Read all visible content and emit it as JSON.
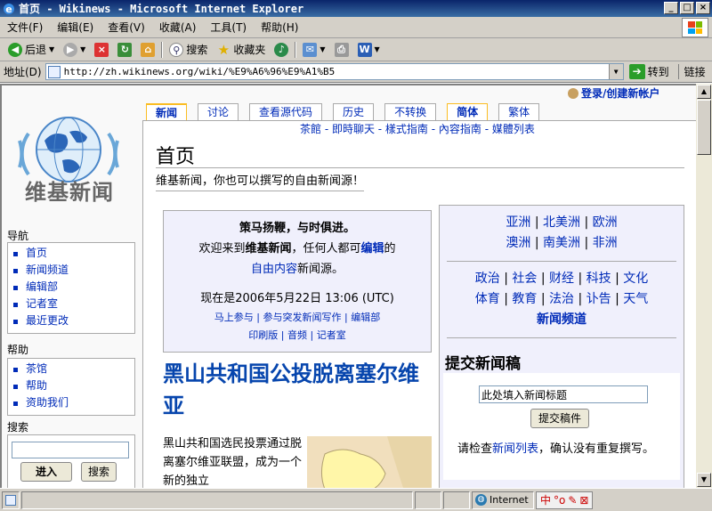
{
  "window": {
    "title": "首页 - Wikinews - Microsoft Internet Explorer",
    "controls": [
      "_",
      "□",
      "×"
    ]
  },
  "menu": [
    "文件(F)",
    "编辑(E)",
    "查看(V)",
    "收藏(A)",
    "工具(T)",
    "帮助(H)"
  ],
  "toolbar": {
    "back": "后退",
    "search": "搜索",
    "favorites": "收藏夹"
  },
  "address": {
    "label": "地址(D)",
    "url": "http://zh.wikinews.org/wiki/%E9%A6%96%E9%A1%B5",
    "go": "转到",
    "links": "链接"
  },
  "status": {
    "zone": "Internet",
    "ime_label": "中"
  },
  "page": {
    "logo_text": "维基新闻",
    "userlink": "登录/创建新帐户",
    "tabs": [
      "新闻",
      "讨论",
      "查看源代码",
      "历史",
      "不转换",
      "简体",
      "繁体"
    ],
    "sublinks": "茶館 - 即時聊天 - 樣式指南 - 內容指南 - 媒體列表",
    "title": "首页",
    "tagline": "维基新闻，你也可以撰写的自由新闻源！",
    "welcome": {
      "motto": "策马扬鞭，与时俱进。",
      "line1_a": "欢迎来到",
      "line1_b": "维基新闻",
      "line1_c": "，任何人都可",
      "line1_d": "编辑",
      "line1_e": "的",
      "line2_a": "自由内容",
      "line2_b": "新闻源。",
      "time": "现在是2006年5月22日  13:06 (UTC)",
      "links1": "马上参与 | 参与突发新闻写作 | 编辑部",
      "links2": "印刷版 | 音频 | 记者室"
    },
    "headline": "黑山共和国公投脱离塞尔维亚",
    "article": "黑山共和国选民投票通过脱离塞尔维亚联盟，成为一个新的独立",
    "regions_row1": [
      "亚洲",
      "北美洲",
      "欧洲"
    ],
    "regions_row2": [
      "澳洲",
      "南美洲",
      "非洲"
    ],
    "topics_row1": [
      "政治",
      "社会",
      "财经",
      "科技",
      "文化"
    ],
    "topics_row2": [
      "体育",
      "教育",
      "法治",
      "讣告",
      "天气"
    ],
    "channel": "新闻频道",
    "submit_head": "提交新闻稿",
    "submit_placeholder": "此处填入新闻标题",
    "submit_button": "提交稿件",
    "submit_note_a": "请检查",
    "submit_note_b": "新闻列表",
    "submit_note_c": "，确认没有重复撰写。"
  },
  "sidebar": {
    "nav_title": "导航",
    "nav": [
      "首页",
      "新闻频道",
      "编辑部",
      "记者室",
      "最近更改"
    ],
    "help_title": "帮助",
    "help": [
      "茶馆",
      "帮助",
      "资助我们"
    ],
    "search_title": "搜索",
    "go_btn": "进入",
    "search_btn": "搜索"
  }
}
